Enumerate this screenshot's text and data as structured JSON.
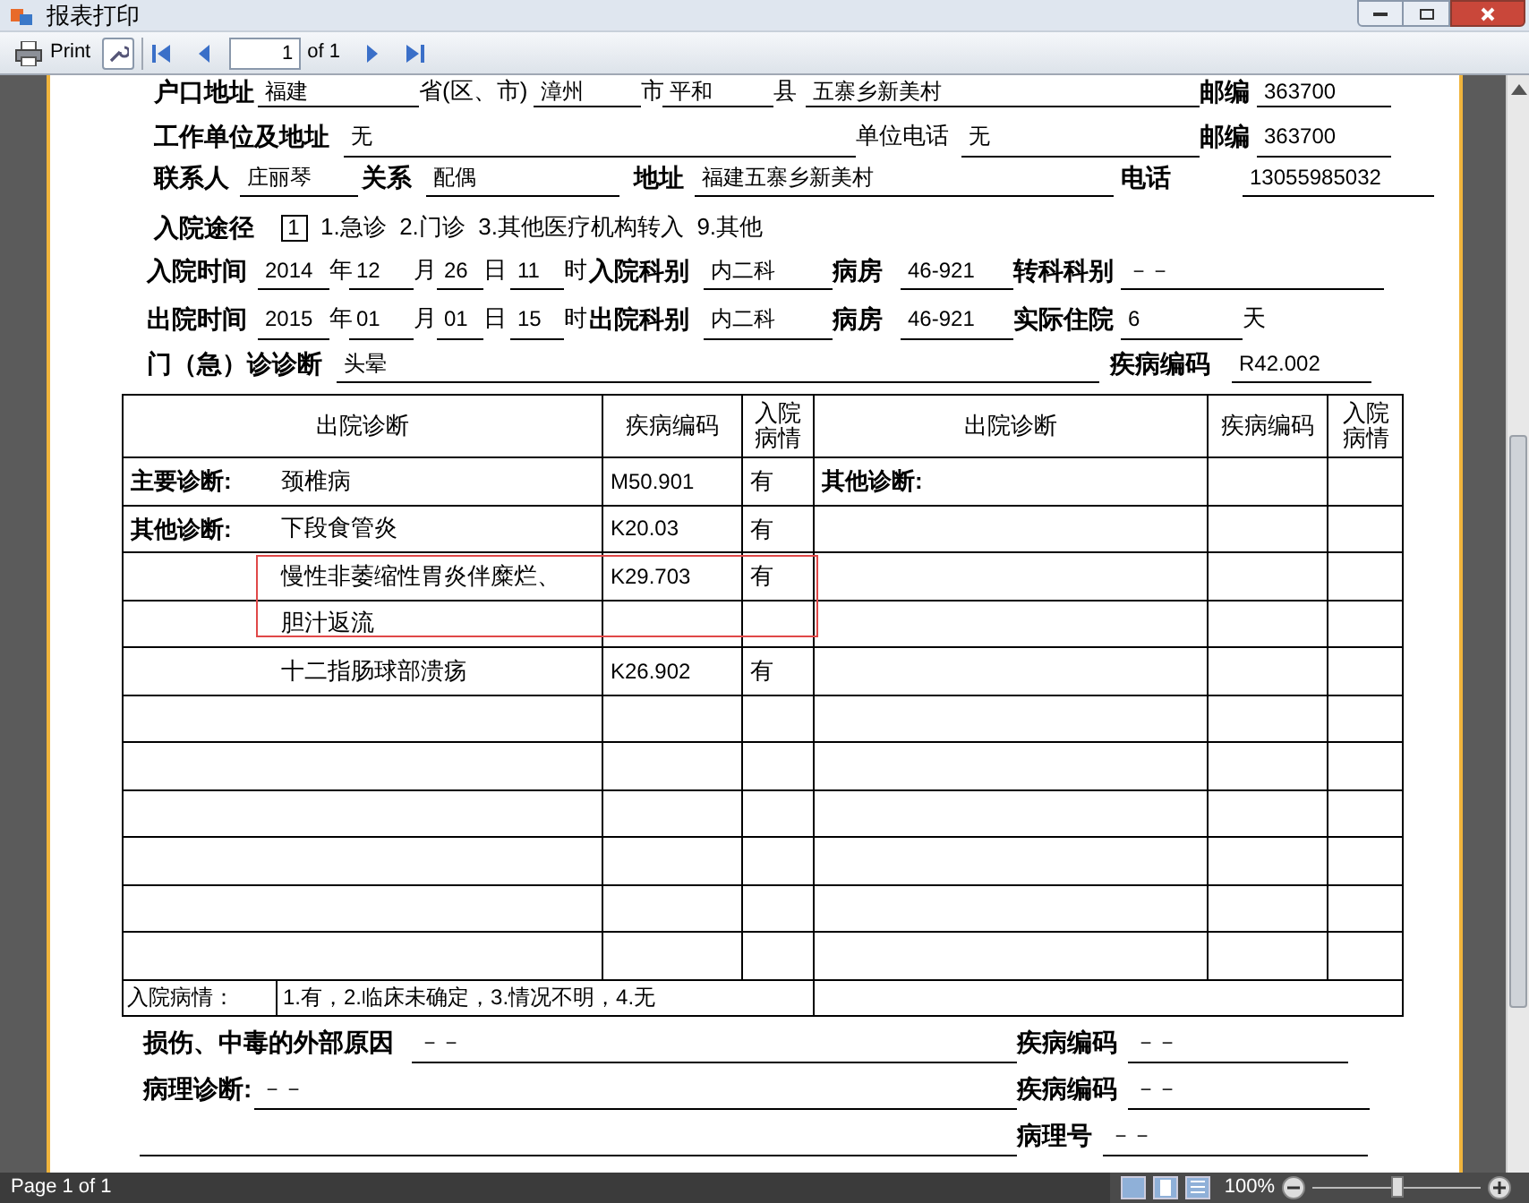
{
  "window": {
    "title": "报表打印"
  },
  "toolbar": {
    "print_label": "Print",
    "page_field": "1",
    "page_total": "of 1"
  },
  "header_rows": [
    [
      {
        "kind": "label",
        "text": "户口地址"
      },
      {
        "kind": "value",
        "text": "福建"
      },
      {
        "kind": "text",
        "text": "省(区、市)"
      },
      {
        "kind": "value",
        "text": "漳州"
      },
      {
        "kind": "text",
        "text": "市"
      },
      {
        "kind": "value",
        "text": "平和"
      },
      {
        "kind": "text",
        "text": "县"
      },
      {
        "kind": "value",
        "text": "五寨乡新美村"
      },
      {
        "kind": "label",
        "text": "邮编"
      },
      {
        "kind": "value",
        "text": "363700"
      }
    ],
    [
      {
        "kind": "label",
        "text": "工作单位及地址"
      },
      {
        "kind": "value",
        "text": "无"
      },
      {
        "kind": "text",
        "text": "单位电话"
      },
      {
        "kind": "value",
        "text": "无"
      },
      {
        "kind": "label",
        "text": "邮编"
      },
      {
        "kind": "value",
        "text": "363700"
      }
    ],
    [
      {
        "kind": "label",
        "text": "联系人"
      },
      {
        "kind": "value",
        "text": "庄丽琴"
      },
      {
        "kind": "label",
        "text": "关系"
      },
      {
        "kind": "value",
        "text": "配偶"
      },
      {
        "kind": "label",
        "text": "地址"
      },
      {
        "kind": "value",
        "text": "福建五寨乡新美村"
      },
      {
        "kind": "label",
        "text": "电话"
      },
      {
        "kind": "value",
        "text": "13055985032"
      }
    ],
    [
      {
        "kind": "label",
        "text": "入院途径"
      },
      {
        "kind": "box",
        "text": "1"
      },
      {
        "kind": "text",
        "text": "1.急诊  2.门诊  3.其他医疗机构转入  9.其他"
      }
    ],
    [
      {
        "kind": "label",
        "text": "入院时间"
      },
      {
        "kind": "value",
        "text": "2014"
      },
      {
        "kind": "text",
        "text": "年"
      },
      {
        "kind": "value",
        "text": "12"
      },
      {
        "kind": "text",
        "text": "月"
      },
      {
        "kind": "value",
        "text": "26"
      },
      {
        "kind": "text",
        "text": "日"
      },
      {
        "kind": "value",
        "text": "11"
      },
      {
        "kind": "text",
        "text": "时"
      },
      {
        "kind": "label",
        "text": "入院科别"
      },
      {
        "kind": "value",
        "text": "内二科"
      },
      {
        "kind": "label",
        "text": "病房"
      },
      {
        "kind": "value",
        "text": "46-921"
      },
      {
        "kind": "label",
        "text": "转科科别"
      },
      {
        "kind": "value",
        "text": "－－"
      }
    ],
    [
      {
        "kind": "label",
        "text": "出院时间"
      },
      {
        "kind": "value",
        "text": "2015"
      },
      {
        "kind": "text",
        "text": "年"
      },
      {
        "kind": "value",
        "text": "01"
      },
      {
        "kind": "text",
        "text": "月"
      },
      {
        "kind": "value",
        "text": "01"
      },
      {
        "kind": "text",
        "text": "日"
      },
      {
        "kind": "value",
        "text": "15"
      },
      {
        "kind": "text",
        "text": "时"
      },
      {
        "kind": "label",
        "text": "出院科别"
      },
      {
        "kind": "value",
        "text": "内二科"
      },
      {
        "kind": "label",
        "text": "病房"
      },
      {
        "kind": "value",
        "text": "46-921"
      },
      {
        "kind": "label",
        "text": "实际住院"
      },
      {
        "kind": "value",
        "text": "6"
      },
      {
        "kind": "text",
        "text": "天"
      }
    ],
    [
      {
        "kind": "label",
        "text": "门（急）诊诊断"
      },
      {
        "kind": "value",
        "text": "头晕"
      },
      {
        "kind": "label",
        "text": "疾病编码"
      },
      {
        "kind": "value",
        "text": "R42.002"
      }
    ]
  ],
  "table": {
    "columns": [
      "出院诊断",
      "疾病编码",
      "入院病情",
      "出院诊断",
      "疾病编码",
      "入院病情"
    ],
    "rows": [
      {
        "left_label": "主要诊断:",
        "diagnosis": "颈椎病",
        "code": "M50.901",
        "condition": "有",
        "right_label": "其他诊断:"
      },
      {
        "left_label": "其他诊断:",
        "diagnosis": "下段食管炎",
        "code": "K20.03",
        "condition": "有"
      },
      {
        "diagnosis": "慢性非萎缩性胃炎伴糜烂、",
        "code": "K29.703",
        "condition": "有"
      },
      {
        "diagnosis": "胆汁返流"
      },
      {
        "diagnosis": "十二指肠球部溃疡",
        "code": "K26.902",
        "condition": "有"
      },
      {},
      {},
      {},
      {},
      {},
      {}
    ],
    "footer": {
      "label": "入院病情：",
      "legend": "1.有，2.临床未确定，3.情况不明，4.无"
    }
  },
  "footer_rows": [
    [
      {
        "kind": "label",
        "text": "损伤、中毒的外部原因"
      },
      {
        "kind": "value",
        "text": "－－"
      },
      {
        "kind": "label",
        "text": "疾病编码"
      },
      {
        "kind": "value",
        "text": "－－"
      }
    ],
    [
      {
        "kind": "label",
        "text": "病理诊断:"
      },
      {
        "kind": "value",
        "text": "－－"
      },
      {
        "kind": "label",
        "text": "疾病编码"
      },
      {
        "kind": "value",
        "text": "－－"
      }
    ],
    [
      {
        "kind": "rule"
      },
      {
        "kind": "label",
        "text": "病理号"
      },
      {
        "kind": "value",
        "text": "－－"
      }
    ]
  ],
  "status_bar": {
    "page": "Page 1 of 1",
    "zoom": "100%",
    "zoom_slider": {
      "level": 0.5
    }
  }
}
